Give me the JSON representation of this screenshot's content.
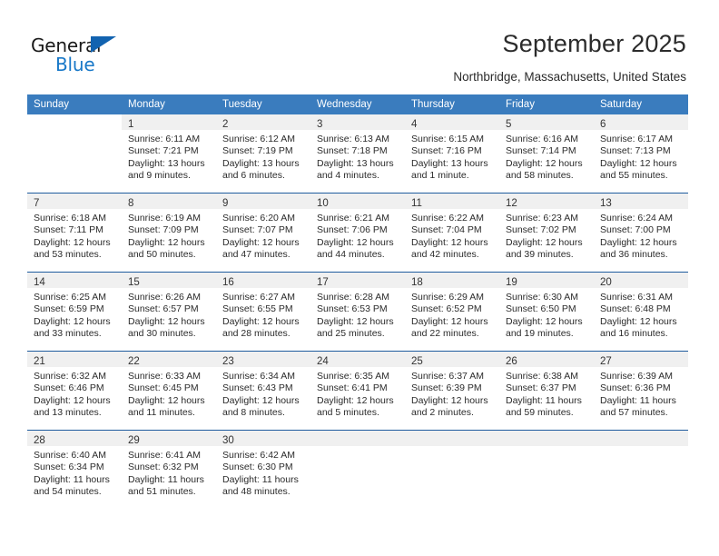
{
  "brand": {
    "name_top": "General",
    "name_bottom": "Blue",
    "accent_color": "#1878c8",
    "triangle_color": "#1263b0"
  },
  "header": {
    "title": "September 2025",
    "subtitle": "Northbridge, Massachusetts, United States",
    "header_row_color": "#3a7cbe"
  },
  "weekdays": [
    "Sunday",
    "Monday",
    "Tuesday",
    "Wednesday",
    "Thursday",
    "Friday",
    "Saturday"
  ],
  "weeks": [
    [
      {
        "day": "",
        "lines": []
      },
      {
        "day": "1",
        "lines": [
          "Sunrise: 6:11 AM",
          "Sunset: 7:21 PM",
          "Daylight: 13 hours",
          "and 9 minutes."
        ]
      },
      {
        "day": "2",
        "lines": [
          "Sunrise: 6:12 AM",
          "Sunset: 7:19 PM",
          "Daylight: 13 hours",
          "and 6 minutes."
        ]
      },
      {
        "day": "3",
        "lines": [
          "Sunrise: 6:13 AM",
          "Sunset: 7:18 PM",
          "Daylight: 13 hours",
          "and 4 minutes."
        ]
      },
      {
        "day": "4",
        "lines": [
          "Sunrise: 6:15 AM",
          "Sunset: 7:16 PM",
          "Daylight: 13 hours",
          "and 1 minute."
        ]
      },
      {
        "day": "5",
        "lines": [
          "Sunrise: 6:16 AM",
          "Sunset: 7:14 PM",
          "Daylight: 12 hours",
          "and 58 minutes."
        ]
      },
      {
        "day": "6",
        "lines": [
          "Sunrise: 6:17 AM",
          "Sunset: 7:13 PM",
          "Daylight: 12 hours",
          "and 55 minutes."
        ]
      }
    ],
    [
      {
        "day": "7",
        "lines": [
          "Sunrise: 6:18 AM",
          "Sunset: 7:11 PM",
          "Daylight: 12 hours",
          "and 53 minutes."
        ]
      },
      {
        "day": "8",
        "lines": [
          "Sunrise: 6:19 AM",
          "Sunset: 7:09 PM",
          "Daylight: 12 hours",
          "and 50 minutes."
        ]
      },
      {
        "day": "9",
        "lines": [
          "Sunrise: 6:20 AM",
          "Sunset: 7:07 PM",
          "Daylight: 12 hours",
          "and 47 minutes."
        ]
      },
      {
        "day": "10",
        "lines": [
          "Sunrise: 6:21 AM",
          "Sunset: 7:06 PM",
          "Daylight: 12 hours",
          "and 44 minutes."
        ]
      },
      {
        "day": "11",
        "lines": [
          "Sunrise: 6:22 AM",
          "Sunset: 7:04 PM",
          "Daylight: 12 hours",
          "and 42 minutes."
        ]
      },
      {
        "day": "12",
        "lines": [
          "Sunrise: 6:23 AM",
          "Sunset: 7:02 PM",
          "Daylight: 12 hours",
          "and 39 minutes."
        ]
      },
      {
        "day": "13",
        "lines": [
          "Sunrise: 6:24 AM",
          "Sunset: 7:00 PM",
          "Daylight: 12 hours",
          "and 36 minutes."
        ]
      }
    ],
    [
      {
        "day": "14",
        "lines": [
          "Sunrise: 6:25 AM",
          "Sunset: 6:59 PM",
          "Daylight: 12 hours",
          "and 33 minutes."
        ]
      },
      {
        "day": "15",
        "lines": [
          "Sunrise: 6:26 AM",
          "Sunset: 6:57 PM",
          "Daylight: 12 hours",
          "and 30 minutes."
        ]
      },
      {
        "day": "16",
        "lines": [
          "Sunrise: 6:27 AM",
          "Sunset: 6:55 PM",
          "Daylight: 12 hours",
          "and 28 minutes."
        ]
      },
      {
        "day": "17",
        "lines": [
          "Sunrise: 6:28 AM",
          "Sunset: 6:53 PM",
          "Daylight: 12 hours",
          "and 25 minutes."
        ]
      },
      {
        "day": "18",
        "lines": [
          "Sunrise: 6:29 AM",
          "Sunset: 6:52 PM",
          "Daylight: 12 hours",
          "and 22 minutes."
        ]
      },
      {
        "day": "19",
        "lines": [
          "Sunrise: 6:30 AM",
          "Sunset: 6:50 PM",
          "Daylight: 12 hours",
          "and 19 minutes."
        ]
      },
      {
        "day": "20",
        "lines": [
          "Sunrise: 6:31 AM",
          "Sunset: 6:48 PM",
          "Daylight: 12 hours",
          "and 16 minutes."
        ]
      }
    ],
    [
      {
        "day": "21",
        "lines": [
          "Sunrise: 6:32 AM",
          "Sunset: 6:46 PM",
          "Daylight: 12 hours",
          "and 13 minutes."
        ]
      },
      {
        "day": "22",
        "lines": [
          "Sunrise: 6:33 AM",
          "Sunset: 6:45 PM",
          "Daylight: 12 hours",
          "and 11 minutes."
        ]
      },
      {
        "day": "23",
        "lines": [
          "Sunrise: 6:34 AM",
          "Sunset: 6:43 PM",
          "Daylight: 12 hours",
          "and 8 minutes."
        ]
      },
      {
        "day": "24",
        "lines": [
          "Sunrise: 6:35 AM",
          "Sunset: 6:41 PM",
          "Daylight: 12 hours",
          "and 5 minutes."
        ]
      },
      {
        "day": "25",
        "lines": [
          "Sunrise: 6:37 AM",
          "Sunset: 6:39 PM",
          "Daylight: 12 hours",
          "and 2 minutes."
        ]
      },
      {
        "day": "26",
        "lines": [
          "Sunrise: 6:38 AM",
          "Sunset: 6:37 PM",
          "Daylight: 11 hours",
          "and 59 minutes."
        ]
      },
      {
        "day": "27",
        "lines": [
          "Sunrise: 6:39 AM",
          "Sunset: 6:36 PM",
          "Daylight: 11 hours",
          "and 57 minutes."
        ]
      }
    ],
    [
      {
        "day": "28",
        "lines": [
          "Sunrise: 6:40 AM",
          "Sunset: 6:34 PM",
          "Daylight: 11 hours",
          "and 54 minutes."
        ]
      },
      {
        "day": "29",
        "lines": [
          "Sunrise: 6:41 AM",
          "Sunset: 6:32 PM",
          "Daylight: 11 hours",
          "and 51 minutes."
        ]
      },
      {
        "day": "30",
        "lines": [
          "Sunrise: 6:42 AM",
          "Sunset: 6:30 PM",
          "Daylight: 11 hours",
          "and 48 minutes."
        ]
      },
      {
        "day": "",
        "lines": []
      },
      {
        "day": "",
        "lines": []
      },
      {
        "day": "",
        "lines": []
      },
      {
        "day": "",
        "lines": []
      }
    ]
  ]
}
